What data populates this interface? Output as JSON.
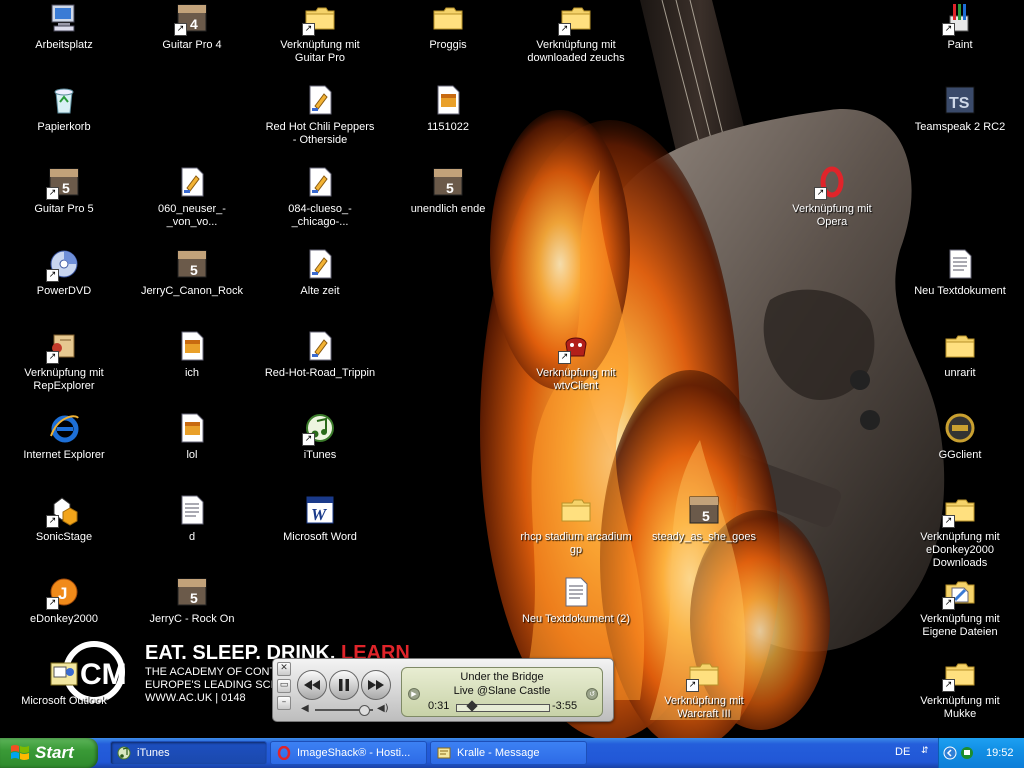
{
  "desktop": {
    "icons": [
      {
        "id": "arbeitsplatz",
        "label": "Arbeitsplatz",
        "kind": "computer",
        "shortcut": false
      },
      {
        "id": "papierkorb",
        "label": "Papierkorb",
        "kind": "recycle",
        "shortcut": false
      },
      {
        "id": "guitarpro5",
        "label": "Guitar Pro 5",
        "kind": "gp5",
        "shortcut": true
      },
      {
        "id": "powerdvd",
        "label": "PowerDVD",
        "kind": "disc",
        "shortcut": true
      },
      {
        "id": "repexplorer",
        "label": "Verknüpfung mit RepExplorer",
        "kind": "scroll",
        "shortcut": true
      },
      {
        "id": "ie",
        "label": "Internet Explorer",
        "kind": "ie",
        "shortcut": false
      },
      {
        "id": "sonicstage",
        "label": "SonicStage",
        "kind": "sonic",
        "shortcut": true
      },
      {
        "id": "edonkey",
        "label": "eDonkey2000",
        "kind": "edonkey",
        "shortcut": true
      },
      {
        "id": "outlook",
        "label": "Microsoft Outlook",
        "kind": "outlook",
        "shortcut": false
      },
      {
        "id": "guitarpro4",
        "label": "Guitar Pro 4",
        "kind": "gp4",
        "shortcut": true
      },
      {
        "id": "neuser",
        "label": "060_neuser_-_von_vo...",
        "kind": "gpfile",
        "shortcut": false
      },
      {
        "id": "canonrock",
        "label": "JerryC_Canon_Rock",
        "kind": "gp5",
        "shortcut": false
      },
      {
        "id": "ich",
        "label": "ich",
        "kind": "doc",
        "shortcut": false
      },
      {
        "id": "lol",
        "label": "lol",
        "kind": "doc",
        "shortcut": false
      },
      {
        "id": "d",
        "label": "d",
        "kind": "txt",
        "shortcut": false
      },
      {
        "id": "rockon",
        "label": "JerryC - Rock On",
        "kind": "gp5",
        "shortcut": false
      },
      {
        "id": "vguitarpro",
        "label": "Verknüpfung mit Guitar Pro",
        "kind": "folder",
        "shortcut": true
      },
      {
        "id": "rhcpotherside",
        "label": "Red Hot Chili Peppers - Otherside",
        "kind": "gpfile",
        "shortcut": false
      },
      {
        "id": "clueso",
        "label": "084-clueso_-_chicago-...",
        "kind": "gpfile",
        "shortcut": false
      },
      {
        "id": "altezeit",
        "label": "Alte zeit",
        "kind": "gpfile",
        "shortcut": false
      },
      {
        "id": "roadtrippin",
        "label": "Red-Hot-Road_Trippin",
        "kind": "gpfile",
        "shortcut": false
      },
      {
        "id": "itunes",
        "label": "iTunes",
        "kind": "itunes",
        "shortcut": true
      },
      {
        "id": "word",
        "label": "Microsoft Word",
        "kind": "word",
        "shortcut": false
      },
      {
        "id": "proggis",
        "label": "Proggis",
        "kind": "folder",
        "shortcut": false
      },
      {
        "id": "f1151022",
        "label": "1151022",
        "kind": "doc",
        "shortcut": false
      },
      {
        "id": "unendlich",
        "label": "unendlich ende",
        "kind": "gp5",
        "shortcut": false
      },
      {
        "id": "downloaded",
        "label": "Verknüpfung mit downloaded zeuchs",
        "kind": "folder",
        "shortcut": true
      },
      {
        "id": "wtv",
        "label": "Verknüpfung mit wtvClient",
        "kind": "wtv",
        "shortcut": true
      },
      {
        "id": "rhcpstadium",
        "label": "rhcp stadium arcadium gp",
        "kind": "folder",
        "shortcut": false
      },
      {
        "id": "neutext2",
        "label": "Neu Textdokument (2)",
        "kind": "txt",
        "shortcut": false
      },
      {
        "id": "steady",
        "label": "steady_as_she_goes",
        "kind": "gp5",
        "shortcut": false
      },
      {
        "id": "warcraft",
        "label": "Verknüpfung mit Warcraft III",
        "kind": "folder",
        "shortcut": true
      },
      {
        "id": "opera",
        "label": "Verknüpfung mit Opera",
        "kind": "opera",
        "shortcut": true
      },
      {
        "id": "paint",
        "label": "Paint",
        "kind": "paint",
        "shortcut": true
      },
      {
        "id": "teamspeak",
        "label": "Teamspeak 2 RC2",
        "kind": "ts",
        "shortcut": false
      },
      {
        "id": "neutext",
        "label": "Neu Textdokument",
        "kind": "txt",
        "shortcut": false
      },
      {
        "id": "unrarit",
        "label": "unrarit",
        "kind": "folder",
        "shortcut": false
      },
      {
        "id": "ggclient",
        "label": "GGclient",
        "kind": "gg",
        "shortcut": false
      },
      {
        "id": "edonkeydl",
        "label": "Verknüpfung mit eDonkey2000 Downloads",
        "kind": "folder",
        "shortcut": true
      },
      {
        "id": "eigenedateien",
        "label": "Verknüpfung mit Eigene Dateien",
        "kind": "mydocs",
        "shortcut": true
      },
      {
        "id": "mukke",
        "label": "Verknüpfung mit Mukke",
        "kind": "folder",
        "shortcut": true
      }
    ]
  },
  "wallpaper_ad": {
    "headline_a": "EAT. SLEEP. DRINK.",
    "headline_b": "LEARN",
    "line1": "THE ACADEMY OF CONTE",
    "line2": "EUROPE'S LEADING SCH",
    "line3": "WWW.AC.UK | 0148"
  },
  "mini_player": {
    "track": "Under the Bridge",
    "album": "Live @Slane Castle",
    "elapsed": "0:31",
    "remaining": "-3:55",
    "progress": 0.12,
    "volume": 0.8
  },
  "taskbar": {
    "start_label": "Start",
    "tasks": [
      {
        "label": "iTunes",
        "icon": "itunes-icon",
        "active": true
      },
      {
        "label": "ImageShack® - Hosti...",
        "icon": "opera-icon",
        "active": false
      },
      {
        "label": "Kralle - Message",
        "icon": "message-icon",
        "active": false
      }
    ],
    "language": "DE",
    "clock": "19:52"
  },
  "colors": {
    "taskbar_blue": "#245edb",
    "start_green": "#3a9a37",
    "tray_blue": "#1290e5",
    "ad_red": "#e0242a"
  }
}
